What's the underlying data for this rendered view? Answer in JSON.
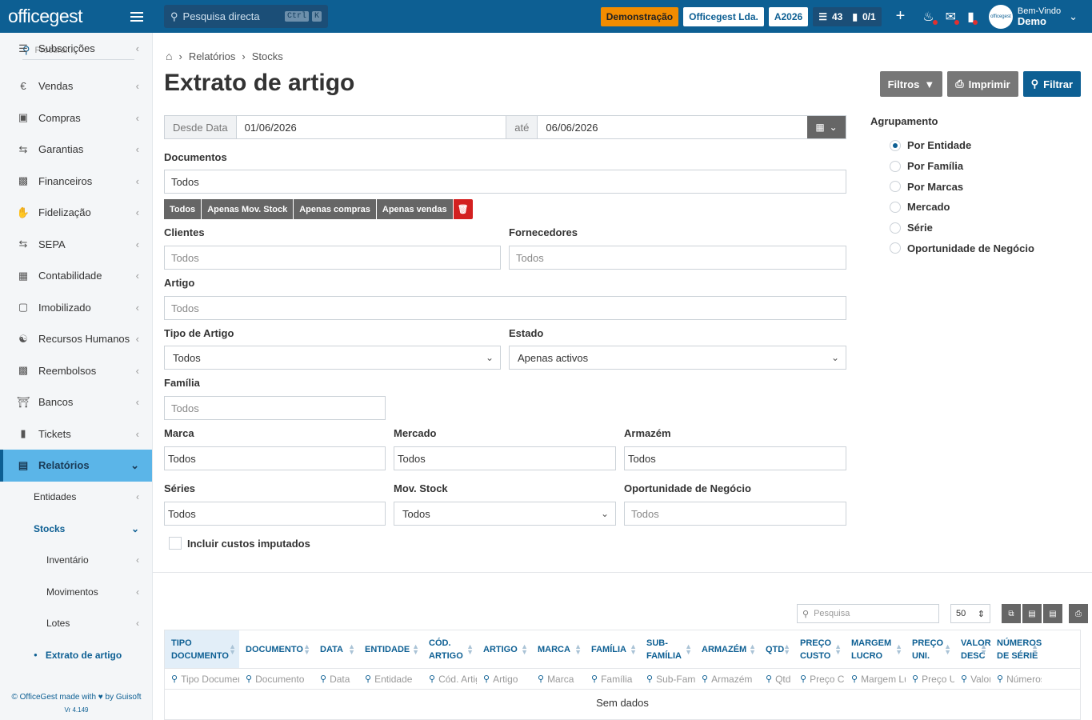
{
  "topbar": {
    "logo": "officegest",
    "search_placeholder": "Pesquisa directa",
    "kbd_ctrl": "Ctrl",
    "kbd_k": "K",
    "demo": "Demonstração",
    "company": "Officegest Lda.",
    "year": "A2026",
    "tasks_count": "43",
    "docs_count": "0/1",
    "greeting": "Bem-Vindo",
    "user": "Demo"
  },
  "sidebar": {
    "search_placeholder": "Procurar...",
    "items": [
      {
        "label": "Subscrições",
        "icon": "list-icon"
      },
      {
        "label": "Vendas",
        "icon": "euro-icon"
      },
      {
        "label": "Compras",
        "icon": "cart-icon"
      },
      {
        "label": "Garantias",
        "icon": "swap-icon"
      },
      {
        "label": "Financeiros",
        "icon": "money-icon"
      },
      {
        "label": "Fidelização",
        "icon": "hand-icon"
      },
      {
        "label": "SEPA",
        "icon": "swap-icon"
      },
      {
        "label": "Contabilidade",
        "icon": "calculator-icon"
      },
      {
        "label": "Imobilizado",
        "icon": "boxes-icon"
      },
      {
        "label": "Recursos Humanos",
        "icon": "people-icon"
      },
      {
        "label": "Reembolsos",
        "icon": "money-icon"
      },
      {
        "label": "Bancos",
        "icon": "bank-icon"
      },
      {
        "label": "Tickets",
        "icon": "ticket-icon"
      },
      {
        "label": "Relatórios",
        "icon": "chart-icon"
      }
    ],
    "sub": {
      "entidades": "Entidades",
      "stocks": "Stocks",
      "inventario": "Inventário",
      "movimentos": "Movimentos",
      "lotes": "Lotes",
      "extrato": "Extrato de artigo"
    },
    "footer": "© OfficeGest made with ♥ by Guisoft",
    "version": "Vr 4.149"
  },
  "breadcrumb": [
    "Relatórios",
    "Stocks"
  ],
  "page_title": "Extrato de artigo",
  "actions": {
    "filtros": "Filtros",
    "imprimir": "Imprimir",
    "filtrar": "Filtrar"
  },
  "dates": {
    "from_label": "Desde Data",
    "from": "01/06/2026",
    "to_label": "até",
    "to": "06/06/2026"
  },
  "form": {
    "documentos_label": "Documentos",
    "documentos_value": "Todos",
    "doc_buttons": [
      "Todos",
      "Apenas Mov. Stock",
      "Apenas compras",
      "Apenas vendas"
    ],
    "clientes_label": "Clientes",
    "clientes_ph": "Todos",
    "fornecedores_label": "Fornecedores",
    "fornecedores_ph": "Todos",
    "artigo_label": "Artigo",
    "artigo_ph": "Todos",
    "tipo_label": "Tipo de Artigo",
    "tipo_value": "Todos",
    "estado_label": "Estado",
    "estado_value": "Apenas activos",
    "familia_label": "Família",
    "familia_ph": "Todos",
    "marca_label": "Marca",
    "marca_value": "Todos",
    "mercado_label": "Mercado",
    "mercado_value": "Todos",
    "armazem_label": "Armazém",
    "armazem_value": "Todos",
    "series_label": "Séries",
    "series_value": "Todos",
    "movstock_label": "Mov. Stock",
    "movstock_value": "Todos",
    "oportunidade_label": "Oportunidade de Negócio",
    "oportunidade_ph": "Todos",
    "custos_label": "Incluir custos imputados"
  },
  "agrupamento": {
    "label": "Agrupamento",
    "options": [
      "Por Entidade",
      "Por Família",
      "Por Marcas",
      "Mercado",
      "Série",
      "Oportunidade de Negócio"
    ],
    "selected": "Por Entidade"
  },
  "grid": {
    "search_placeholder": "Pesquisa",
    "page_size": "50",
    "columns": [
      {
        "h1": "TIPO",
        "h2": "DOCUMENTO",
        "filter": "Tipo Documento"
      },
      {
        "h1": "DOCUMENTO",
        "h2": "",
        "filter": "Documento"
      },
      {
        "h1": "DATA",
        "h2": "",
        "filter": "Data"
      },
      {
        "h1": "ENTIDADE",
        "h2": "",
        "filter": "Entidade"
      },
      {
        "h1": "CÓD.",
        "h2": "ARTIGO",
        "filter": "Cód. Artigo"
      },
      {
        "h1": "ARTIGO",
        "h2": "",
        "filter": "Artigo"
      },
      {
        "h1": "MARCA",
        "h2": "",
        "filter": "Marca"
      },
      {
        "h1": "FAMÍLIA",
        "h2": "",
        "filter": "Família"
      },
      {
        "h1": "SUB-",
        "h2": "FAMÍLIA",
        "filter": "Sub-Família"
      },
      {
        "h1": "ARMAZÉM",
        "h2": "",
        "filter": "Armazém"
      },
      {
        "h1": "QTD",
        "h2": "",
        "filter": "Qtd"
      },
      {
        "h1": "PREÇO",
        "h2": "CUSTO",
        "filter": "Preço Custo"
      },
      {
        "h1": "MARGEM",
        "h2": "LUCRO",
        "filter": "Margem Lucro"
      },
      {
        "h1": "PREÇO",
        "h2": "UNI.",
        "filter": "Preço Uni."
      },
      {
        "h1": "VALOR",
        "h2": "DESC",
        "filter": "Valor Desc"
      },
      {
        "h1": "NÚMEROS",
        "h2": "DE SÉRIE",
        "filter": "Números de Série"
      }
    ],
    "empty": "Sem dados"
  }
}
